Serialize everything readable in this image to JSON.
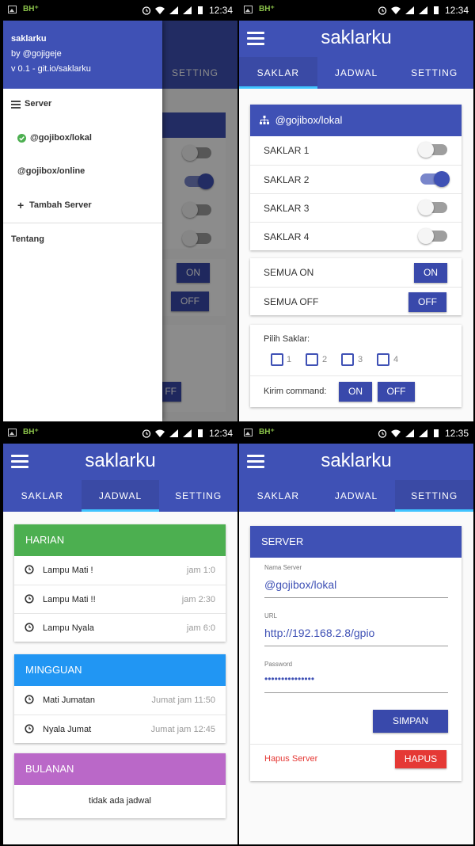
{
  "status_times": [
    "12:34",
    "12:34",
    "12:34",
    "12:35"
  ],
  "colors": {
    "primary": "#3f51b5",
    "tab_indicator": "#40c4ff",
    "harian": "#4caf50",
    "mingguan": "#2196f3",
    "bulanan": "#ba68c8",
    "danger": "#e53935"
  },
  "app": {
    "title": "saklarku",
    "tabs": [
      "SAKLAR",
      "JADWAL",
      "SETTING"
    ]
  },
  "drawer": {
    "app_name": "saklarku",
    "author": "by @gojigeje",
    "version": "v 0.1 - git.io/saklarku",
    "server_header": "Server",
    "servers": [
      "@gojibox/lokal",
      "@gojibox/online"
    ],
    "add_server": "Tambah Server",
    "about": "Tentang",
    "bg_tab": "SETTING",
    "bg_on": "ON",
    "bg_off": "OFF",
    "bg_off2": "FF"
  },
  "saklar": {
    "server_title": "@gojibox/lokal",
    "switches": [
      {
        "label": "SAKLAR 1",
        "on": false
      },
      {
        "label": "SAKLAR 2",
        "on": true
      },
      {
        "label": "SAKLAR 3",
        "on": false
      },
      {
        "label": "SAKLAR 4",
        "on": false
      }
    ],
    "all_on_label": "SEMUA ON",
    "all_on_btn": "ON",
    "all_off_label": "SEMUA OFF",
    "all_off_btn": "OFF",
    "pilih_label": "Pilih Saklar:",
    "checkboxes": [
      "1",
      "2",
      "3",
      "4"
    ],
    "kirim_label": "Kirim command:",
    "kirim_on": "ON",
    "kirim_off": "OFF"
  },
  "jadwal": {
    "harian": {
      "title": "HARIAN",
      "items": [
        {
          "name": "Lampu Mati !",
          "time": "jam 1:0"
        },
        {
          "name": "Lampu Mati !!",
          "time": "jam 2:30"
        },
        {
          "name": "Lampu Nyala",
          "time": "jam 6:0"
        }
      ]
    },
    "mingguan": {
      "title": "MINGGUAN",
      "items": [
        {
          "name": "Mati Jumatan",
          "time": "Jumat jam 11:50"
        },
        {
          "name": "Nyala Jumat",
          "time": "Jumat jam 12:45"
        }
      ]
    },
    "bulanan": {
      "title": "BULANAN",
      "empty": "tidak ada jadwal"
    }
  },
  "setting": {
    "card_title": "SERVER",
    "name_label": "Nama Server",
    "name_value": "@gojibox/lokal",
    "url_label": "URL",
    "url_value": "http://192.168.2.8/gpio",
    "password_label": "Password",
    "password_value": "•••••••••••••••",
    "save_btn": "SIMPAN",
    "delete_label": "Hapus Server",
    "delete_btn": "HAPUS"
  }
}
